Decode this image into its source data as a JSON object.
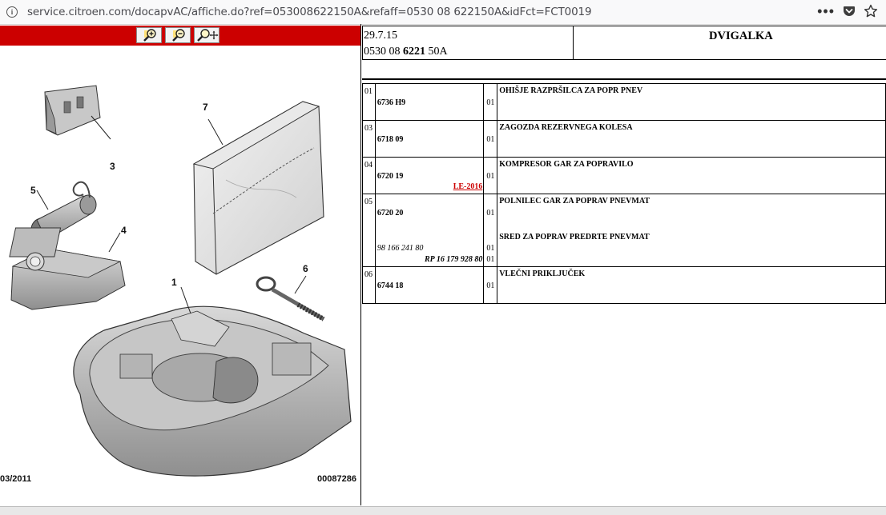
{
  "browser": {
    "url": "service.citroen.com/docapvAC/affiche.do?ref=053008622150A&refaff=0530 08 622150A&idFct=FCT0019"
  },
  "image_pane": {
    "date_code": "03/2011",
    "image_code": "00087286",
    "callouts": [
      "7",
      "3",
      "5",
      "4",
      "1",
      "6"
    ]
  },
  "header": {
    "date": "29.7.15",
    "ref_prefix": "0530 08",
    "ref_bold": "6221",
    "ref_suffix": "50A",
    "title": "DVIGALKA"
  },
  "parts": [
    {
      "num": "01",
      "ref": "6736 H9",
      "qty": "01",
      "desc": "OHIŠJE RAZPRŠILCA ZA POPR PNEV"
    },
    {
      "num": "03",
      "ref": "6718 09",
      "qty": "01",
      "desc": "ZAGOZDA REZERVNEGA KOLESA"
    },
    {
      "num": "04",
      "ref": "6720 19",
      "qty": "01",
      "desc": "KOMPRESOR GAR ZA POPRAVILO",
      "link": "LE-2016"
    },
    {
      "num": "05",
      "ref": "6720 20",
      "qty": "01",
      "desc": "POLNILEC GAR ZA POPRAV PNEVMAT",
      "desc2": "SRED ZA POPRAV PREDRTE PNEVMAT",
      "alt_ref": "98 166 241 80",
      "alt_qty": "01",
      "alt_ref2": "RP 16 179 928 80",
      "alt_qty2": "01"
    },
    {
      "num": "06",
      "ref": "6744 18",
      "qty": "01",
      "desc": "VLEČNI PRIKLJUČEK"
    }
  ]
}
